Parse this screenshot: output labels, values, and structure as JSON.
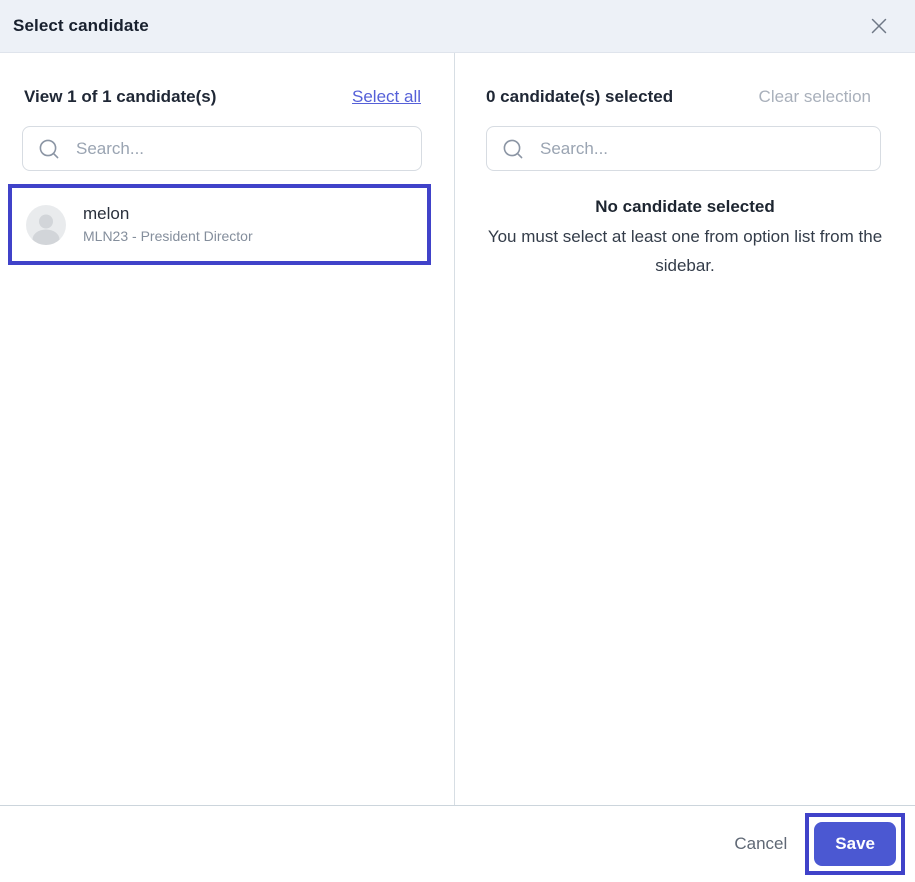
{
  "modal": {
    "title": "Select candidate"
  },
  "left_panel": {
    "header": "View 1 of 1 candidate(s)",
    "select_all_label": "Select all",
    "search": {
      "value": "",
      "placeholder": "Search..."
    },
    "candidates": [
      {
        "name": "melon",
        "subtitle": "MLN23 - President Director"
      }
    ]
  },
  "right_panel": {
    "header": "0 candidate(s) selected",
    "clear_selection_label": "Clear selection",
    "search": {
      "value": "",
      "placeholder": "Search..."
    },
    "empty_state": {
      "title": "No candidate selected",
      "message": "You must select at least one from option list from the sidebar."
    }
  },
  "footer": {
    "cancel_label": "Cancel",
    "save_label": "Save"
  },
  "icons": {
    "close": "x-cross",
    "search": "magnifier",
    "avatar": "person-silhouette"
  },
  "colors": {
    "accent_button": "#4b58d2",
    "annotation_highlight": "#4042c9",
    "link": "#5560d8",
    "header_background": "#edf1f7",
    "muted_text": "#a9b0bb"
  }
}
